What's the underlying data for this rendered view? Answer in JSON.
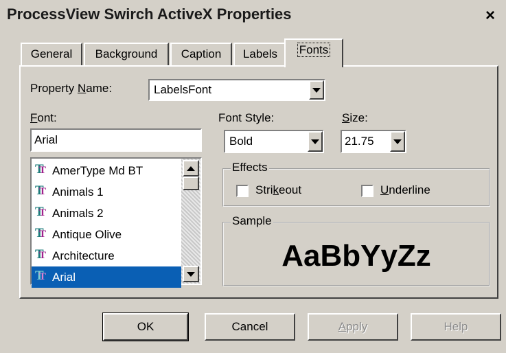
{
  "window": {
    "title": "ProcessView Swirch ActiveX Properties",
    "close": "×"
  },
  "tabs": [
    {
      "label": "General"
    },
    {
      "label": "Background"
    },
    {
      "label": "Caption"
    },
    {
      "label": "Labels"
    },
    {
      "label": "Fonts",
      "active": true
    }
  ],
  "property_name": {
    "label_pre": "Property ",
    "label_u": "N",
    "label_post": "ame:",
    "value": "LabelsFont"
  },
  "font": {
    "label_u": "F",
    "label_post": "ont:",
    "value": "Arial",
    "items": [
      "AmerType Md BT",
      "Animals 1",
      "Animals 2",
      "Antique Olive",
      "Architecture",
      "Arial"
    ],
    "selected_index": 5
  },
  "font_style": {
    "label": "Font Style:",
    "value": "Bold"
  },
  "size": {
    "label_u": "S",
    "label_post": "ize:",
    "value": "21.75"
  },
  "effects": {
    "label": "Effects",
    "strikeout": {
      "pre": "Stri",
      "u": "k",
      "post": "eout",
      "checked": false
    },
    "underline": {
      "pre": "",
      "u": "U",
      "post": "nderline",
      "checked": false
    }
  },
  "sample": {
    "label": "Sample",
    "text": "AaBbYyZz"
  },
  "buttons": {
    "ok": "OK",
    "cancel": "Cancel",
    "apply_u": "A",
    "apply_post": "pply",
    "help": "Help"
  },
  "icons": {
    "font_type": "truetype-font-icon",
    "dropdown": "chevron-down-icon"
  },
  "colors": {
    "selection": "#0a5fb4",
    "face": "#d4d0c8"
  }
}
